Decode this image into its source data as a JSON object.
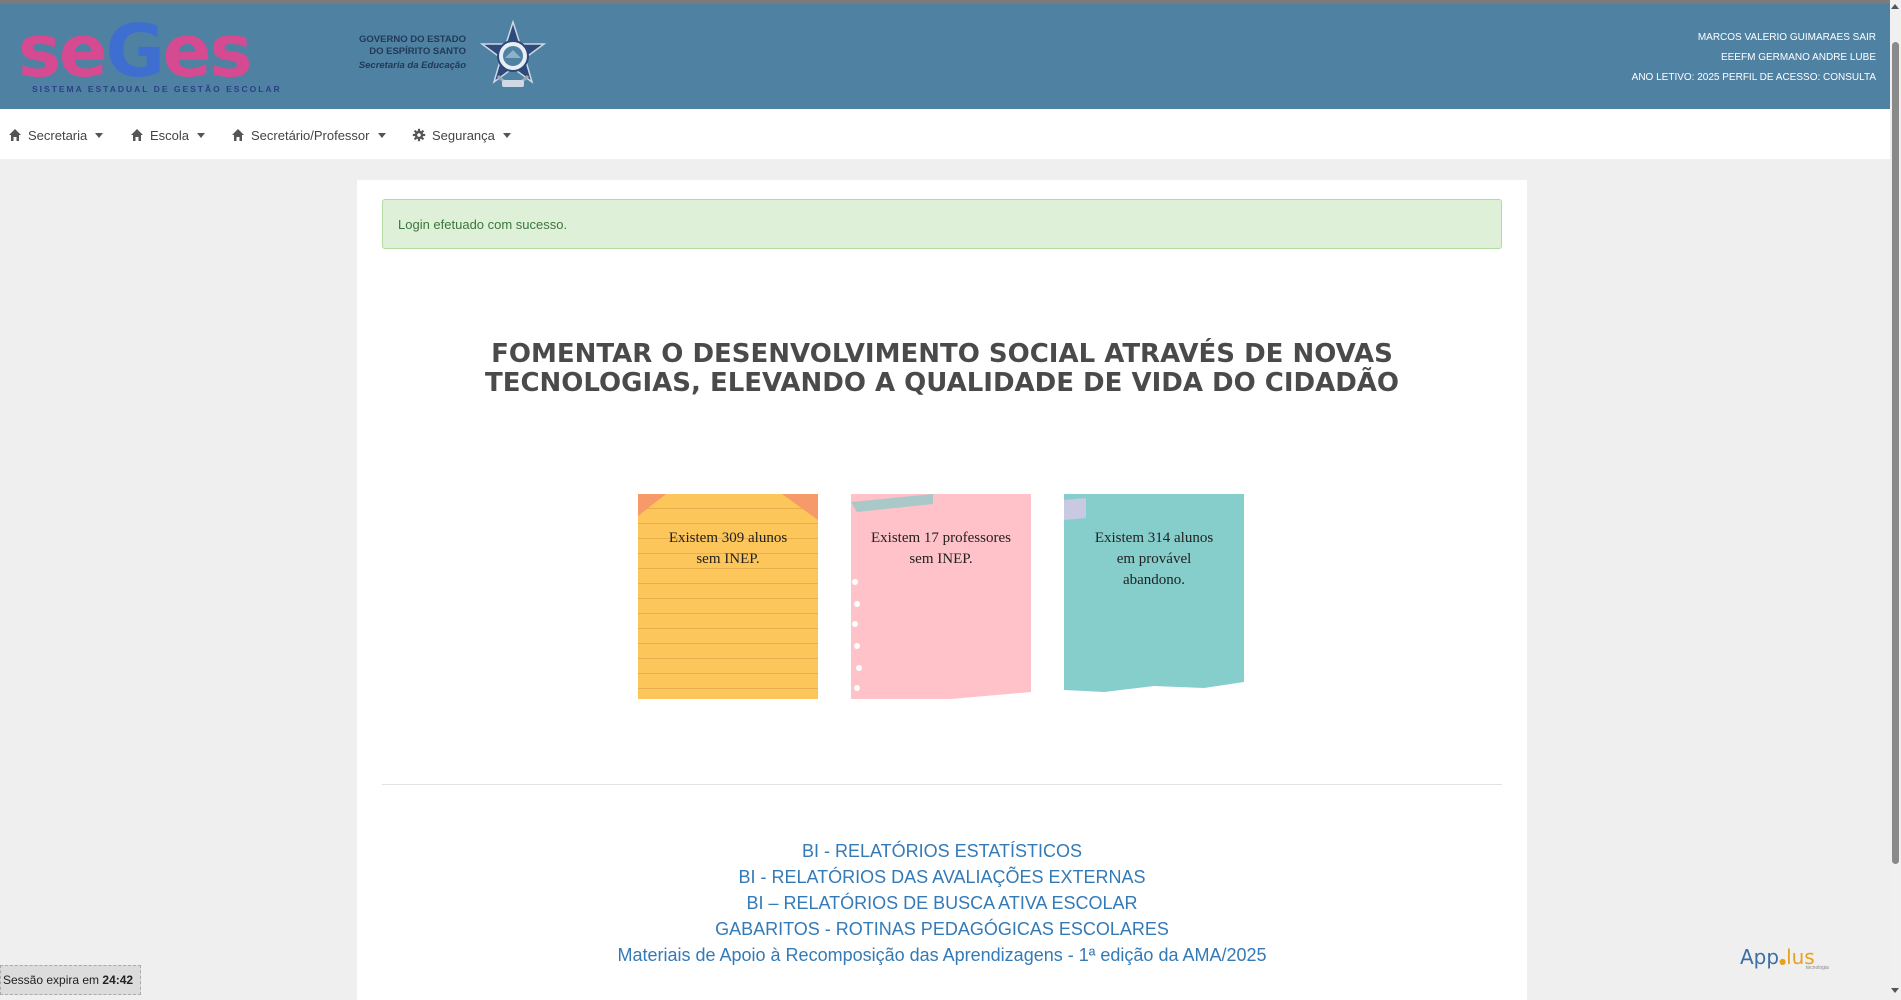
{
  "header": {
    "logo": {
      "part1": "se",
      "part2": "G",
      "part3": "e",
      "part4": "s",
      "subtitle": "SISTEMA ESTADUAL DE GESTÃO ESCOLAR"
    },
    "gov": {
      "line1": "GOVERNO DO ESTADO",
      "line2": "DO ESPÍRITO SANTO",
      "line3": "Secretaria da Educação"
    },
    "user": {
      "name": "MARCOS VALERIO GUIMARAES SAIR",
      "school": "EEEFM GERMANO ANDRE LUBE",
      "year_profile": "ANO LETIVO: 2025 PERFIL DE ACESSO: CONSULTA"
    },
    "colors": {
      "bar": "#4f81a3",
      "logo_pink": "#d64a91",
      "logo_blue": "#3f6ed1"
    }
  },
  "nav": {
    "items": [
      {
        "label": "Secretaria",
        "icon": "home-icon"
      },
      {
        "label": "Escola",
        "icon": "home-icon"
      },
      {
        "label": "Secretário/Professor",
        "icon": "home-icon"
      },
      {
        "label": "Segurança",
        "icon": "gear-icon"
      }
    ]
  },
  "main": {
    "alert": "Login efetuado com sucesso.",
    "slogan": {
      "line1": "FOMENTAR O DESENVOLVIMENTO SOCIAL ATRAVÉS DE NOVAS",
      "line2": "TECNOLOGIAS, ELEVANDO A QUALIDADE DE VIDA DO CIDADÃO"
    },
    "notes": [
      {
        "line1": "Existem 309 alunos",
        "line2": "sem INEP.",
        "color": "#fcc65a"
      },
      {
        "line1": "Existem 17 professores",
        "line2": "sem INEP.",
        "color": "#ffc2c9"
      },
      {
        "line1": "Existem 314 alunos",
        "line2": "em provável",
        "line3": "abandono.",
        "color": "#86cecc"
      }
    ],
    "links": [
      "BI - RELATÓRIOS ESTATÍSTICOS",
      "BI - RELATÓRIOS DAS AVALIAÇÕES EXTERNAS",
      "BI – RELATÓRIOS DE BUSCA ATIVA ESCOLAR",
      "GABARITOS - ROTINAS PEDAGÓGICAS ESCOLARES",
      "Materiais de Apoio à Recomposição das Aprendizagens - 1ª edição da AMA/2025"
    ]
  },
  "footer": {
    "session_label": "Sessão expira em",
    "session_time": "24:42",
    "brand_part1": "App",
    "brand_part2": "lus",
    "brand_sub": "tecnologia"
  }
}
